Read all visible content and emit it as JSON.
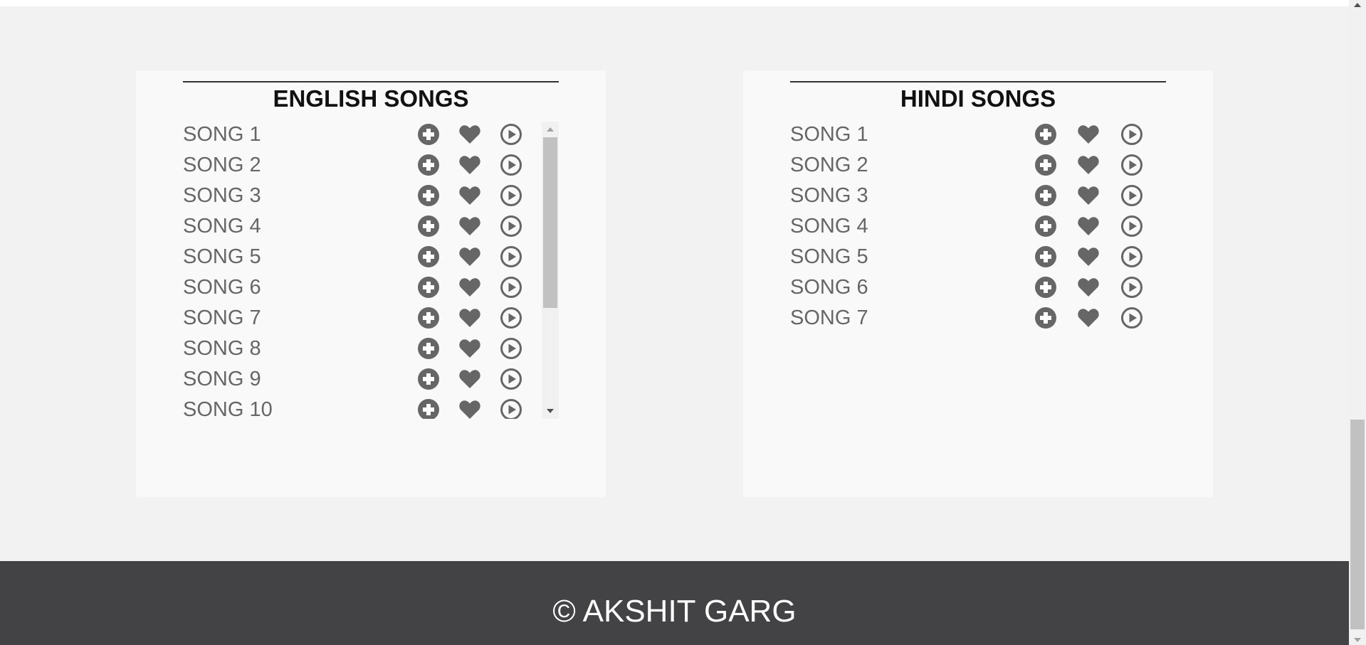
{
  "english": {
    "title": "ENGLISH SONGS",
    "songs": [
      {
        "name": "SONG 1"
      },
      {
        "name": "SONG 2"
      },
      {
        "name": "SONG 3"
      },
      {
        "name": "SONG 4"
      },
      {
        "name": "SONG 5"
      },
      {
        "name": "SONG 6"
      },
      {
        "name": "SONG 7"
      },
      {
        "name": "SONG 8"
      },
      {
        "name": "SONG 9"
      },
      {
        "name": "SONG 10"
      }
    ]
  },
  "hindi": {
    "title": "HINDI SONGS",
    "songs": [
      {
        "name": "SONG 1"
      },
      {
        "name": "SONG 2"
      },
      {
        "name": "SONG 3"
      },
      {
        "name": "SONG 4"
      },
      {
        "name": "SONG 5"
      },
      {
        "name": "SONG 6"
      },
      {
        "name": "SONG 7"
      }
    ]
  },
  "row_icons": [
    "plus-circle-icon",
    "heart-icon",
    "play-circle-icon"
  ],
  "footer": {
    "text": "© AKSHIT GARG"
  },
  "colors": {
    "background": "#f2f2f2",
    "panel": "#f9f9f9",
    "icon": "#666666",
    "song_text": "#666666",
    "footer_bg": "#434345",
    "footer_text": "#ffffff"
  }
}
